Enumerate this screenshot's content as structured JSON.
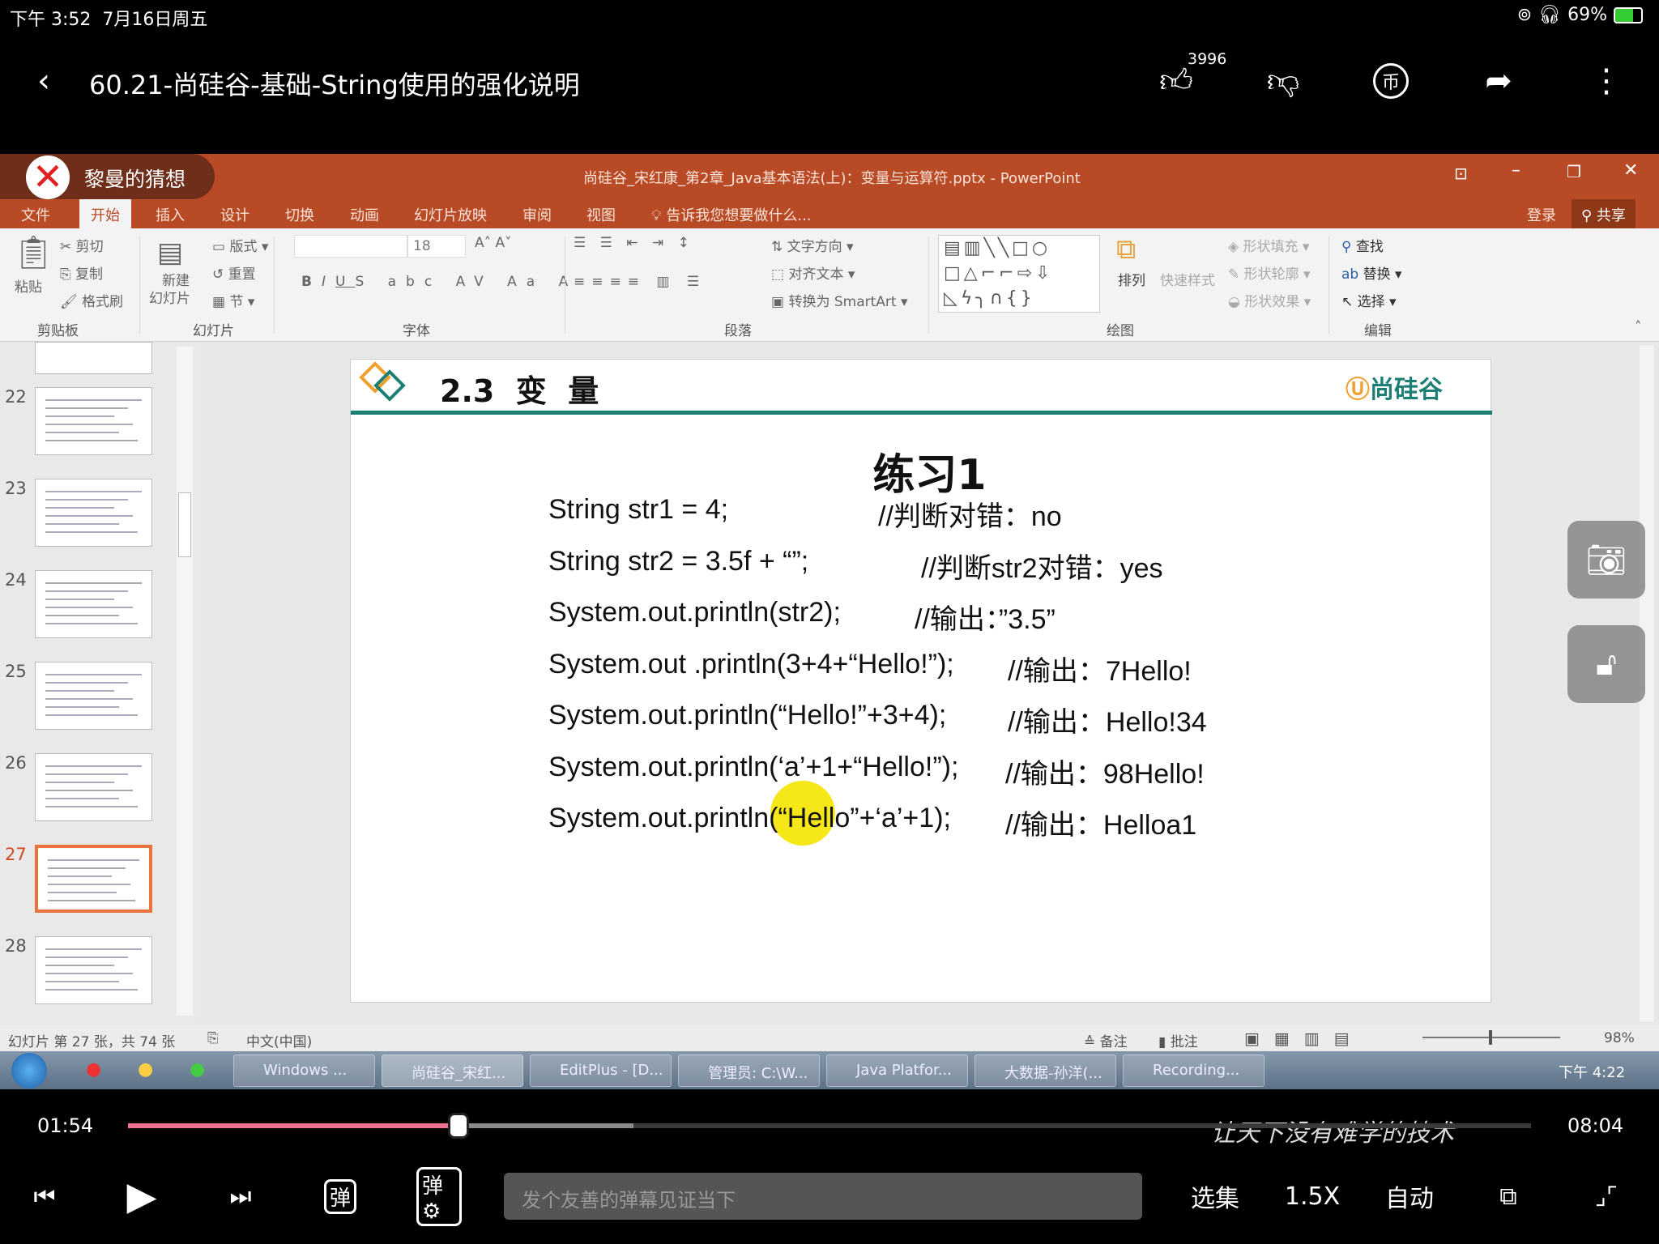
{
  "status_bar": {
    "time": "下午 3:52",
    "date": "7月16日周五",
    "battery": "69%"
  },
  "header": {
    "title": "60.21-尚硅谷-基础-String使用的强化说明",
    "like_count": "3996",
    "icons": [
      "back-icon",
      "thumbs-up-icon",
      "thumbs-down-icon",
      "coin-icon",
      "share-icon",
      "more-icon"
    ]
  },
  "uploader_badge": "黎曼的猜想",
  "ppt": {
    "window_title": "尚硅谷_宋红康_第2章_Java基本语法(上)：变量与运算符.pptx - PowerPoint",
    "tabs": [
      "文件",
      "开始",
      "插入",
      "设计",
      "切换",
      "动画",
      "幻灯片放映",
      "审阅",
      "视图"
    ],
    "tell_me": "告诉我您想要做什么...",
    "login": "登录",
    "share": "共享",
    "ribbon": {
      "clipboard": {
        "label": "剪贴板",
        "paste": "粘贴",
        "cut": "剪切",
        "copy": "复制",
        "format_painter": "格式刷"
      },
      "slides": {
        "label": "幻灯片",
        "new_slide_1": "新建",
        "new_slide_2": "幻灯片",
        "layout": "版式",
        "reset": "重置",
        "section": "节"
      },
      "font": {
        "label": "字体",
        "size": "18"
      },
      "paragraph": {
        "label": "段落",
        "text_direction": "文字方向",
        "align_text": "对齐文本",
        "smartart": "转换为 SmartArt"
      },
      "drawing": {
        "label": "绘图",
        "arrange": "排列",
        "quick_styles": "快速样式",
        "fill": "形状填充",
        "outline": "形状轮廓",
        "effects": "形状效果"
      },
      "editing": {
        "label": "编辑",
        "find": "查找",
        "replace": "替换",
        "select": "选择"
      }
    },
    "thumbnails": [
      "22",
      "23",
      "24",
      "25",
      "26",
      "27",
      "28"
    ],
    "selected_slide": "27",
    "slide": {
      "section": "2.3  变  量",
      "logo": "尚硅谷",
      "heading": "练习1",
      "lines": [
        {
          "code": "String str1 = 4;",
          "comment": "//判断对错：no"
        },
        {
          "code": "String str2 = 3.5f + “”;",
          "comment": "//判断str2对错：yes"
        },
        {
          "code": "System.out.println(str2);",
          "comment": "//输出：”3.5”"
        },
        {
          "code": "System.out .println(3+4+“Hello!”);",
          "comment": "//输出：7Hello!"
        },
        {
          "code": "System.out.println(“Hello!”+3+4);",
          "comment": "//输出：Hello!34"
        },
        {
          "code": "System.out.println(‘a’+1+“Hello!”);",
          "comment": "//输出：98Hello!"
        },
        {
          "code": "System.out.println(“Hello”+‘a’+1);",
          "comment": "//输出：Helloa1"
        }
      ],
      "watermark": "让天下没有难学的技术",
      "accent": "#1b7f74"
    },
    "statusbar": {
      "slide_info": "幻灯片 第 27 张，共 74 张",
      "language": "中文(中国)",
      "notes": "备注",
      "comments": "批注",
      "zoom": "98%"
    },
    "taskbar": {
      "items": [
        "Windows ...",
        "尚硅谷_宋红...",
        "EditPlus - [D...",
        "管理员: C:\\W...",
        "Java Platfor...",
        "大数据-孙洋(...",
        "Recording..."
      ],
      "clock": "下午 4:22"
    }
  },
  "player": {
    "current": "01:54",
    "duration": "08:04",
    "progress": 0.2355,
    "buffered": 0.36,
    "danmaku_placeholder": "发个友善的弹幕见证当下",
    "episodes": "选集",
    "speed": "1.5X",
    "quality": "自动",
    "progress_color": "#f07394"
  }
}
